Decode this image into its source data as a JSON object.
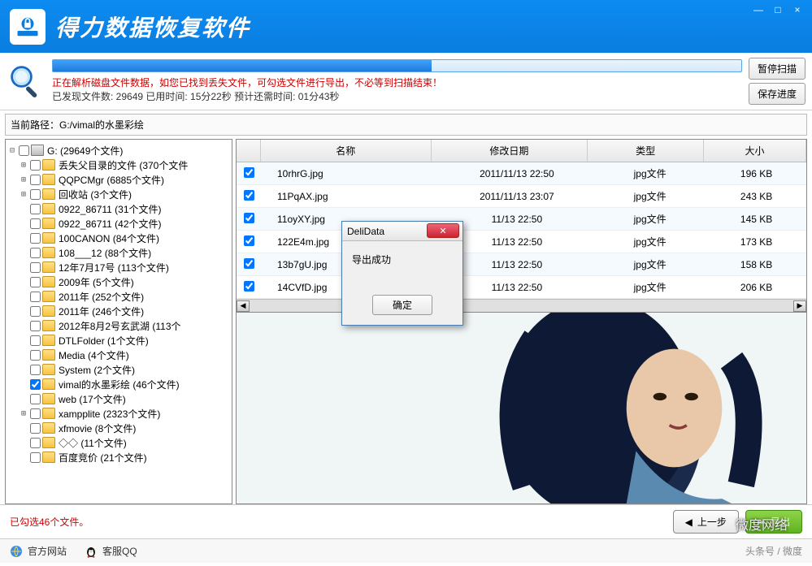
{
  "app": {
    "title": "得力数据恢复软件"
  },
  "win": {
    "min": "—",
    "max": "□",
    "close": "×"
  },
  "status": {
    "warning": "正在解析磁盘文件数据，如您已找到丢失文件，可勾选文件进行导出，不必等到扫描结束！",
    "info": "已发现文件数: 29649  已用时间: 15分22秒  预计还需时间: 01分43秒",
    "pause": "暂停扫描",
    "save": "保存进度"
  },
  "path": {
    "label": "当前路径：",
    "value": "G:/vimal的水墨彩绘"
  },
  "tree": {
    "root": "G:  (29649个文件)",
    "items": [
      "丢失父目录的文件  (370个文件",
      "QQPCMgr  (6885个文件)",
      "回收站  (3个文件)",
      "0922_86711  (31个文件)",
      "0922_86711  (42个文件)",
      "100CANON  (84个文件)",
      "108___12  (88个文件)",
      "12年7月17号  (113个文件)",
      "2009年  (5个文件)",
      "2011年  (252个文件)",
      "2011年  (246个文件)",
      "2012年8月2号玄武湖  (113个",
      "DTLFolder  (1个文件)",
      "Media  (4个文件)",
      "System  (2个文件)",
      "vimal的水墨彩绘  (46个文件)",
      "web  (17个文件)",
      "xampplite  (2323个文件)",
      "xfmovie  (8个文件)",
      "◇◇  (11个文件)",
      "百度竞价  (21个文件)"
    ]
  },
  "grid": {
    "headers": {
      "name": "名称",
      "date": "修改日期",
      "type": "类型",
      "size": "大小"
    },
    "rows": [
      {
        "name": "10rhrG.jpg",
        "date": "2011/11/13 22:50",
        "type": "jpg文件",
        "size": "196 KB"
      },
      {
        "name": "11PqAX.jpg",
        "date": "2011/11/13 23:07",
        "type": "jpg文件",
        "size": "243 KB"
      },
      {
        "name": "11oyXY.jpg",
        "date": "11/13 22:50",
        "type": "jpg文件",
        "size": "145 KB"
      },
      {
        "name": "122E4m.jpg",
        "date": "11/13 22:50",
        "type": "jpg文件",
        "size": "173 KB"
      },
      {
        "name": "13b7gU.jpg",
        "date": "11/13 22:50",
        "type": "jpg文件",
        "size": "158 KB"
      },
      {
        "name": "14CVfD.jpg",
        "date": "11/13 22:50",
        "type": "jpg文件",
        "size": "206 KB"
      }
    ]
  },
  "dialog": {
    "title": "DeliData",
    "message": "导出成功",
    "ok": "确定"
  },
  "footer": {
    "selected": "已勾选46个文件。",
    "prev": "上一步",
    "export": "导出",
    "site": "官方网站",
    "qq": "客服QQ",
    "attr": "头条号 / 微度",
    "wm": "微度网络"
  }
}
